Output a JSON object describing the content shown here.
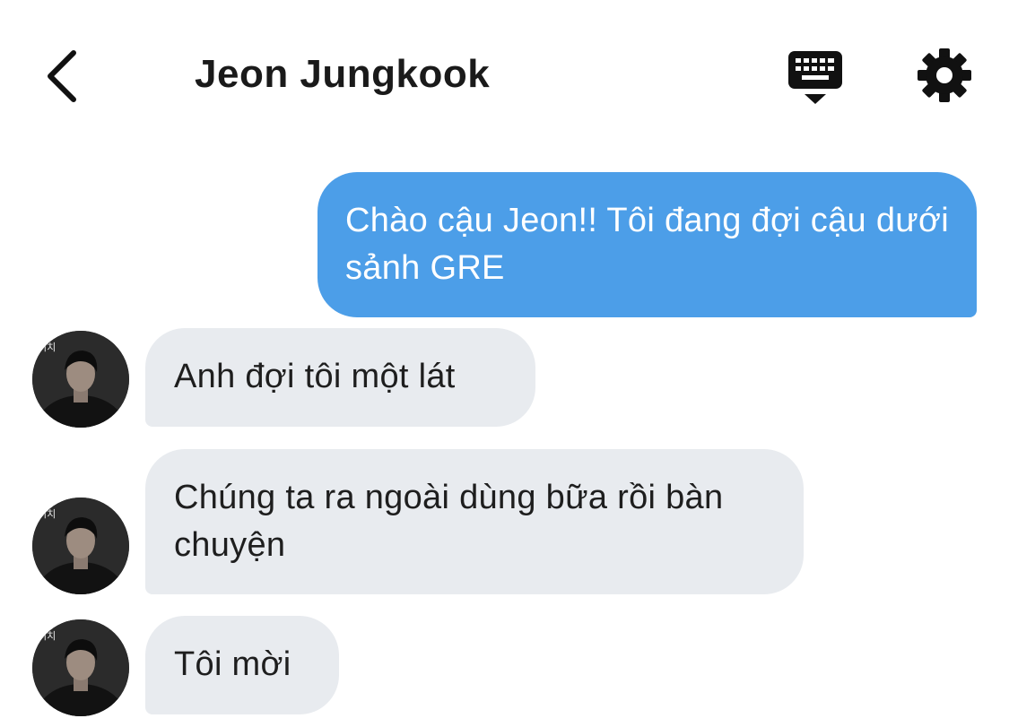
{
  "header": {
    "title": "Jeon Jungkook",
    "back_icon": "chevron-left-icon",
    "keyboard_icon": "keyboard-hide-icon",
    "settings_icon": "gear-icon"
  },
  "messages": [
    {
      "direction": "outgoing",
      "text": "Chào cậu Jeon!! Tôi đang đợi cậu dưới sảnh GRE"
    },
    {
      "direction": "incoming",
      "text": "Anh đợi tôi một lát"
    },
    {
      "direction": "incoming",
      "text": "Chúng ta ra ngoài dùng bữa rồi bàn chuyện"
    },
    {
      "direction": "incoming",
      "text": "Tôi mời"
    }
  ],
  "colors": {
    "outgoing_bubble": "#4c9ee8",
    "incoming_bubble": "#e8ebef",
    "icon": "#111111"
  }
}
